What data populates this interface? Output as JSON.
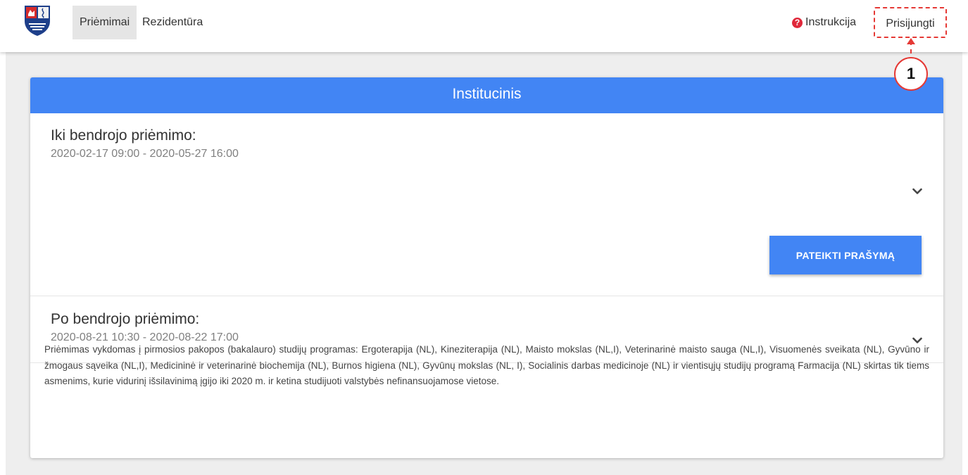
{
  "nav": {
    "items": [
      {
        "label": "Priėmimai",
        "active": true
      },
      {
        "label": "Rezidentūra",
        "active": false
      }
    ],
    "help_label": "Instrukcija",
    "login_label": "Prisijungti"
  },
  "annotation": {
    "number": "1"
  },
  "card": {
    "header": "Institucinis",
    "sections": [
      {
        "title": "Iki bendrojo priėmimo:",
        "dates": "2020-02-17 09:00 - 2020-05-27 16:00",
        "button": "PATEIKTI PRAŠYMĄ"
      },
      {
        "title": "Po bendrojo priėmimo:",
        "dates": "2020-08-21 10:30 - 2020-08-22 17:00"
      }
    ],
    "description": "Priėmimas vykdomas į pirmosios pakopos (bakalauro) studijų programas: Ergoterapija (NL), Kineziterapija (NL), Maisto mokslas (NL,I), Veterinarinė maisto sauga (NL,I), Visuomenės sveikata (NL), Gyvūno ir žmogaus sąveika (NL,I), Medicininė ir veterinarinė biochemija (NL), Burnos higiena (NL), Gyvūnų mokslas (NL, I), Socialinis darbas medicinoje (NL) ir vientisųjų studijų programą Farmacija (NL) skirtas tik tiems asmenims, kurie vidurinį išsilavinimą įgijo iki 2020 m. ir ketina studijuoti valstybės nefinansuojamose vietose."
  },
  "colors": {
    "primary": "#4285f4",
    "annotation": "#e53935",
    "help_icon": "#e0283a"
  },
  "icons": [
    "university-logo",
    "question-circle-icon",
    "chevron-down-icon"
  ]
}
